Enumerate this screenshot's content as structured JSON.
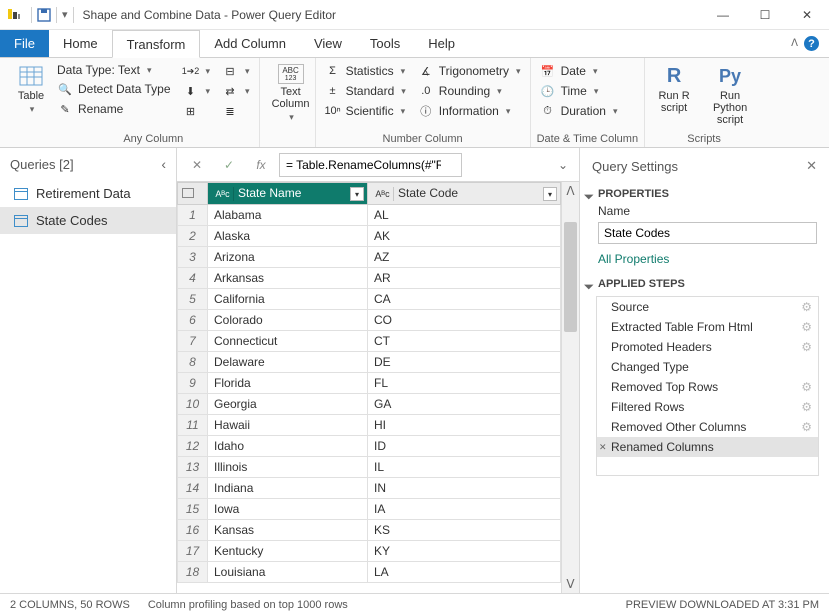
{
  "titlebar": {
    "title": "Shape and Combine Data - Power Query Editor"
  },
  "tabs": {
    "file": "File",
    "home": "Home",
    "transform": "Transform",
    "addcol": "Add Column",
    "view": "View",
    "tools": "Tools",
    "help": "Help"
  },
  "ribbon": {
    "table": "Table",
    "datatype": "Data Type: Text",
    "detect": "Detect Data Type",
    "rename": "Rename",
    "anycol": "Any Column",
    "textcol": "Text Column",
    "statistics": "Statistics",
    "standard": "Standard",
    "scientific": "Scientific",
    "trig": "Trigonometry",
    "rounding": "Rounding",
    "info": "Information",
    "numcol": "Number Column",
    "date": "Date",
    "time": "Time",
    "duration": "Duration",
    "dtcol": "Date & Time Column",
    "runr": "Run R script",
    "runpy": "Run Python script",
    "scripts": "Scripts"
  },
  "queries": {
    "header": "Queries [2]",
    "items": [
      {
        "label": "Retirement Data"
      },
      {
        "label": "State Codes"
      }
    ]
  },
  "formula": {
    "text": "= Table.RenameColumns(#\"Removed"
  },
  "columns": {
    "c1": "State Name",
    "c2": "State Code"
  },
  "rows": [
    {
      "n": "1",
      "a": "Alabama",
      "b": "AL"
    },
    {
      "n": "2",
      "a": "Alaska",
      "b": "AK"
    },
    {
      "n": "3",
      "a": "Arizona",
      "b": "AZ"
    },
    {
      "n": "4",
      "a": "Arkansas",
      "b": "AR"
    },
    {
      "n": "5",
      "a": "California",
      "b": "CA"
    },
    {
      "n": "6",
      "a": "Colorado",
      "b": "CO"
    },
    {
      "n": "7",
      "a": "Connecticut",
      "b": "CT"
    },
    {
      "n": "8",
      "a": "Delaware",
      "b": "DE"
    },
    {
      "n": "9",
      "a": "Florida",
      "b": "FL"
    },
    {
      "n": "10",
      "a": "Georgia",
      "b": "GA"
    },
    {
      "n": "11",
      "a": "Hawaii",
      "b": "HI"
    },
    {
      "n": "12",
      "a": "Idaho",
      "b": "ID"
    },
    {
      "n": "13",
      "a": "Illinois",
      "b": "IL"
    },
    {
      "n": "14",
      "a": "Indiana",
      "b": "IN"
    },
    {
      "n": "15",
      "a": "Iowa",
      "b": "IA"
    },
    {
      "n": "16",
      "a": "Kansas",
      "b": "KS"
    },
    {
      "n": "17",
      "a": "Kentucky",
      "b": "KY"
    },
    {
      "n": "18",
      "a": "Louisiana",
      "b": "LA"
    }
  ],
  "settings": {
    "header": "Query Settings",
    "properties": "PROPERTIES",
    "name_lbl": "Name",
    "name_val": "State Codes",
    "allprops": "All Properties",
    "applied": "APPLIED STEPS",
    "steps": [
      {
        "label": "Source",
        "gear": true
      },
      {
        "label": "Extracted Table From Html",
        "gear": true
      },
      {
        "label": "Promoted Headers",
        "gear": true
      },
      {
        "label": "Changed Type",
        "gear": false
      },
      {
        "label": "Removed Top Rows",
        "gear": true
      },
      {
        "label": "Filtered Rows",
        "gear": true
      },
      {
        "label": "Removed Other Columns",
        "gear": true
      },
      {
        "label": "Renamed Columns",
        "gear": false,
        "sel": true
      }
    ]
  },
  "status": {
    "cols": "2 COLUMNS, 50 ROWS",
    "profile": "Column profiling based on top 1000 rows",
    "preview": "PREVIEW DOWNLOADED AT 3:31 PM"
  }
}
